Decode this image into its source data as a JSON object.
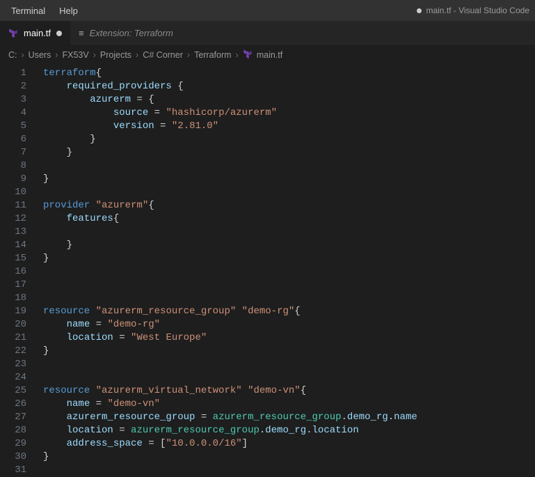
{
  "menubar": {
    "items": [
      "Terminal",
      "Help"
    ],
    "title_prefix_dot": true,
    "title": "main.tf - Visual Studio Code"
  },
  "tabs": [
    {
      "label": "main.tf",
      "icon": "terraform",
      "active": true,
      "dirty": true,
      "italic": false
    },
    {
      "label": "Extension: Terraform",
      "icon": "ext",
      "active": false,
      "dirty": false,
      "italic": true
    }
  ],
  "breadcrumbs": {
    "segments": [
      "C:",
      "Users",
      "FX53V",
      "Projects",
      "C# Corner",
      "Terraform"
    ],
    "file_icon": "terraform",
    "file": "main.tf"
  },
  "editor": {
    "first_line": 1,
    "last_line": 31,
    "lines": [
      [
        [
          "kw",
          "terraform"
        ],
        [
          "punc",
          "{"
        ]
      ],
      [
        [
          "punc",
          "    "
        ],
        [
          "prop",
          "required_providers"
        ],
        [
          "punc",
          " {"
        ]
      ],
      [
        [
          "punc",
          "        "
        ],
        [
          "prop",
          "azurerm"
        ],
        [
          "punc",
          " = {"
        ]
      ],
      [
        [
          "punc",
          "            "
        ],
        [
          "prop",
          "source"
        ],
        [
          "punc",
          " = "
        ],
        [
          "str",
          "\"hashicorp/azurerm\""
        ]
      ],
      [
        [
          "punc",
          "            "
        ],
        [
          "prop",
          "version"
        ],
        [
          "punc",
          " = "
        ],
        [
          "str",
          "\"2.81.0\""
        ]
      ],
      [
        [
          "punc",
          "        }"
        ]
      ],
      [
        [
          "punc",
          "    }"
        ]
      ],
      [],
      [
        [
          "punc",
          "}"
        ]
      ],
      [],
      [
        [
          "kw",
          "provider"
        ],
        [
          "punc",
          " "
        ],
        [
          "str",
          "\"azurerm\""
        ],
        [
          "punc",
          "{"
        ]
      ],
      [
        [
          "punc",
          "    "
        ],
        [
          "prop",
          "features"
        ],
        [
          "punc",
          "{"
        ]
      ],
      [],
      [
        [
          "punc",
          "    }"
        ]
      ],
      [
        [
          "punc",
          "}"
        ]
      ],
      [],
      [],
      [],
      [
        [
          "kw",
          "resource"
        ],
        [
          "punc",
          " "
        ],
        [
          "str",
          "\"azurerm_resource_group\""
        ],
        [
          "punc",
          " "
        ],
        [
          "str",
          "\"demo-rg\""
        ],
        [
          "punc",
          "{"
        ]
      ],
      [
        [
          "punc",
          "    "
        ],
        [
          "prop",
          "name"
        ],
        [
          "punc",
          " = "
        ],
        [
          "str",
          "\"demo-rg\""
        ]
      ],
      [
        [
          "punc",
          "    "
        ],
        [
          "prop",
          "location"
        ],
        [
          "punc",
          " = "
        ],
        [
          "str",
          "\"West Europe\""
        ]
      ],
      [
        [
          "punc",
          "}"
        ]
      ],
      [],
      [],
      [
        [
          "kw",
          "resource"
        ],
        [
          "punc",
          " "
        ],
        [
          "str",
          "\"azurerm_virtual_network\""
        ],
        [
          "punc",
          " "
        ],
        [
          "str",
          "\"demo-vn\""
        ],
        [
          "punc",
          "{"
        ]
      ],
      [
        [
          "punc",
          "    "
        ],
        [
          "prop",
          "name"
        ],
        [
          "punc",
          " = "
        ],
        [
          "str",
          "\"demo-vn\""
        ]
      ],
      [
        [
          "punc",
          "    "
        ],
        [
          "prop",
          "azurerm_resource_group"
        ],
        [
          "punc",
          " = "
        ],
        [
          "type",
          "azurerm_resource_group"
        ],
        [
          "punc",
          "."
        ],
        [
          "prop",
          "demo_rg"
        ],
        [
          "punc",
          "."
        ],
        [
          "prop",
          "name"
        ]
      ],
      [
        [
          "punc",
          "    "
        ],
        [
          "prop",
          "location"
        ],
        [
          "punc",
          " = "
        ],
        [
          "type",
          "azurerm_resource_group"
        ],
        [
          "punc",
          "."
        ],
        [
          "prop",
          "demo_rg"
        ],
        [
          "punc",
          "."
        ],
        [
          "prop",
          "location"
        ]
      ],
      [
        [
          "punc",
          "    "
        ],
        [
          "prop",
          "address_space"
        ],
        [
          "punc",
          " = ["
        ],
        [
          "str",
          "\"10.0.0.0/16\""
        ],
        [
          "punc",
          "]"
        ]
      ],
      [
        [
          "punc",
          "}"
        ]
      ],
      []
    ]
  }
}
